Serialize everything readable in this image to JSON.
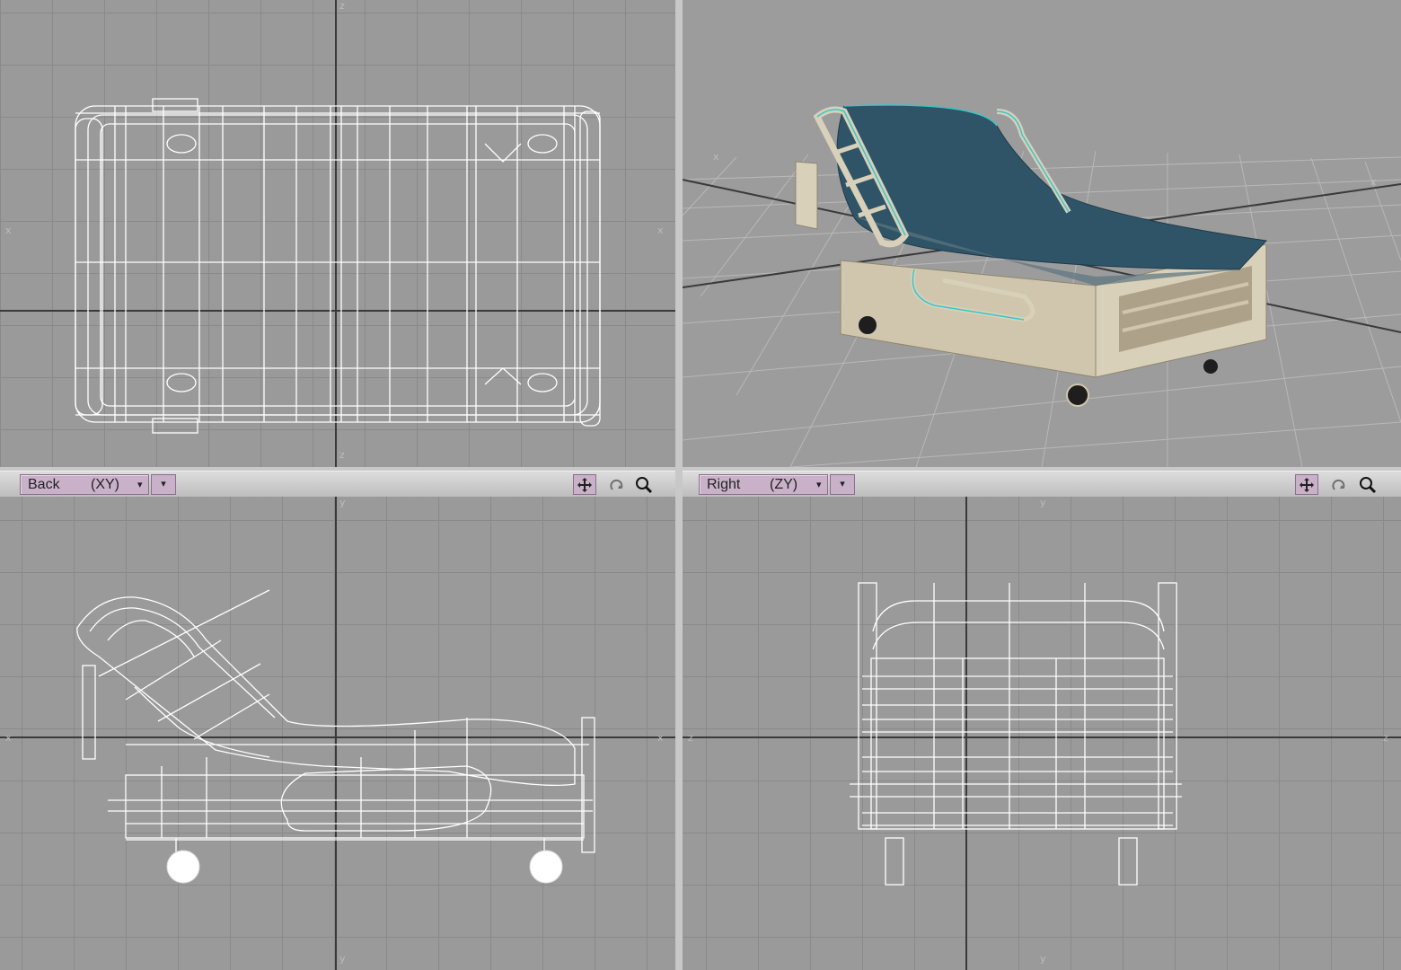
{
  "viewports": {
    "top": {
      "label": ""
    },
    "perspective": {
      "label": ""
    },
    "back": {
      "label": "Back",
      "axes": "(XY)"
    },
    "right": {
      "label": "Right",
      "axes": "(ZY)"
    }
  },
  "icons": {
    "move": "move-icon",
    "rotate": "rotate-icon",
    "zoom": "zoom-icon",
    "dropdown": "chevron-down-icon"
  },
  "glyphs": {
    "caret": "▾"
  },
  "colors": {
    "viewport_bg": "#9a9a9a",
    "grid": "#8a8a8a",
    "wireframe": "#ffffff",
    "mattress": "#2f5467",
    "frame": "#d9d0ba",
    "selection": "#35c9c9",
    "button_mauve": "#c9b2c9"
  }
}
